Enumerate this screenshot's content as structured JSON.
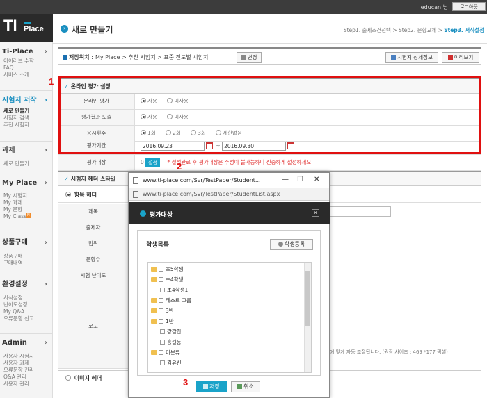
{
  "topbar": {
    "user": "educan 님",
    "logout": "로그아웃"
  },
  "logo": {
    "ti": "TI",
    "place": "Place"
  },
  "sidebar": {
    "sections": [
      {
        "title": "Ti-Place",
        "items": [
          "아이러브 수학",
          "FAQ",
          "서비스 소개"
        ]
      },
      {
        "title": "시험지 저작",
        "items": [
          "새로 만들기",
          "시험지 검색",
          "추천 시험지"
        ]
      },
      {
        "title": "과제",
        "items": [
          "새로 만들기"
        ]
      },
      {
        "title": "My Place",
        "items": [
          "My 시험지",
          "My 과제",
          "My 문항",
          "My Class"
        ]
      },
      {
        "title": "상품구매",
        "items": [
          "상품구매",
          "구매내역"
        ]
      },
      {
        "title": "환경설정",
        "items": [
          "서식설정",
          "난이도설정",
          "My Q&A",
          "오류문항 신고"
        ]
      },
      {
        "title": "Admin",
        "items": [
          "사용자 시험지",
          "사용자 과제",
          "오류문항 관리",
          "Q&A 관리",
          "사용자 관리"
        ]
      }
    ],
    "myclass_badge": "N"
  },
  "header": {
    "title": "새로 만들기",
    "step1": "Step1. 출제조건선택",
    "step2": "Step2. 문항교체",
    "step3": "Step3. 서식설정",
    "sep": ">"
  },
  "location": {
    "label": "저장위치 :",
    "path": "My Place > 추천 시험지 > 표준 진도별 시험지",
    "change": "변경",
    "detail": "시험지 상세정보",
    "preview": "미리보기"
  },
  "online": {
    "title": "온라인 평가 설정",
    "rows": [
      {
        "label": "온라인 평가",
        "options": [
          "사용",
          "미사용"
        ],
        "selected": 0
      },
      {
        "label": "평가결과 노출",
        "options": [
          "사용",
          "미사용"
        ],
        "selected": 0
      },
      {
        "label": "응시횟수",
        "options": [
          "1회",
          "2회",
          "3회",
          "제한없음"
        ],
        "selected": 0
      }
    ],
    "period_label": "평가기간",
    "start": "2016.09.23",
    "tilde": "~",
    "end": "2016.09.30",
    "target_label": "평가대상",
    "target_count": "0",
    "target_btn": "설정",
    "warning": "* 설정완료 후 평가대상은 수정이 불가능하니 신중하게 설정하세요."
  },
  "header_style": {
    "title": "시험지 헤더 스타일",
    "item_header": "항목 헤더",
    "image_header": "이미지 헤더",
    "rows": [
      "제목",
      "출제자",
      "범위",
      "문항수",
      "시험 난이도",
      "로고"
    ],
    "note": "에 맞게 자동 조절됩니다. (권장 사이즈 : 469 *177 픽셀)"
  },
  "annotations": [
    "1",
    "2",
    "3"
  ],
  "popup": {
    "window_title": "www.ti-place.com/Svr/TestPaper/Student...",
    "url": "www.ti-place.com/Svr/TestPaper/StudentList.aspx",
    "header": "평가대상",
    "list_title": "학생목록",
    "register": "학생등록",
    "tree": [
      {
        "label": "초5학생",
        "type": "folder"
      },
      {
        "label": "초4학생",
        "type": "folder"
      },
      {
        "label": "초4학생1",
        "type": "leaf"
      },
      {
        "label": "테스트 그룹",
        "type": "folder"
      },
      {
        "label": "3반",
        "type": "folder"
      },
      {
        "label": "1반",
        "type": "folder"
      },
      {
        "label": "강감찬",
        "type": "leaf"
      },
      {
        "label": "홍길동",
        "type": "leaf"
      },
      {
        "label": "미분류",
        "type": "folder"
      },
      {
        "label": "김유신",
        "type": "leaf"
      }
    ],
    "save": "저장",
    "cancel": "취소"
  }
}
